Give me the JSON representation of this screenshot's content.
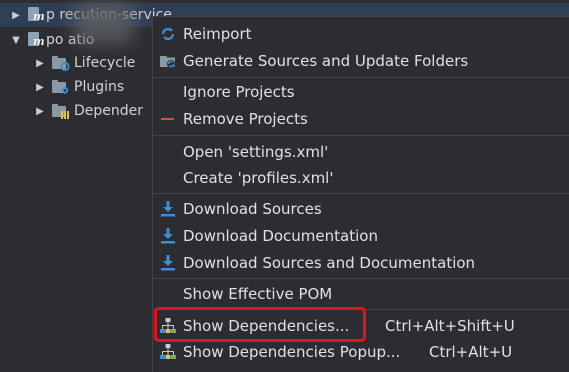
{
  "tree": {
    "project1_label": "p     recution-service",
    "project2_label": "po           atio",
    "children": [
      "Lifecycle",
      "Plugins",
      "Depender"
    ]
  },
  "menu": {
    "reimport": "Reimport",
    "generate_sources": "Generate Sources and Update Folders",
    "ignore_projects": "Ignore Projects",
    "remove_projects": "Remove Projects",
    "open_settings": "Open 'settings.xml'",
    "create_profiles": "Create 'profiles.xml'",
    "download_sources": "Download Sources",
    "download_documentation": "Download Documentation",
    "download_sources_and_docs": "Download Sources and Documentation",
    "show_effective_pom": "Show Effective POM",
    "show_dependencies": "Show Dependencies...",
    "show_dependencies_shortcut": "Ctrl+Alt+Shift+U",
    "show_dependencies_popup": "Show Dependencies Popup...",
    "show_dependencies_popup_shortcut": "Ctrl+Alt+U"
  },
  "colors": {
    "background": "#2b2d30",
    "selection": "#2f3d55",
    "highlight_border": "#e0141e",
    "icon_blue": "#3d8fd6",
    "remove_red": "#c75450"
  }
}
